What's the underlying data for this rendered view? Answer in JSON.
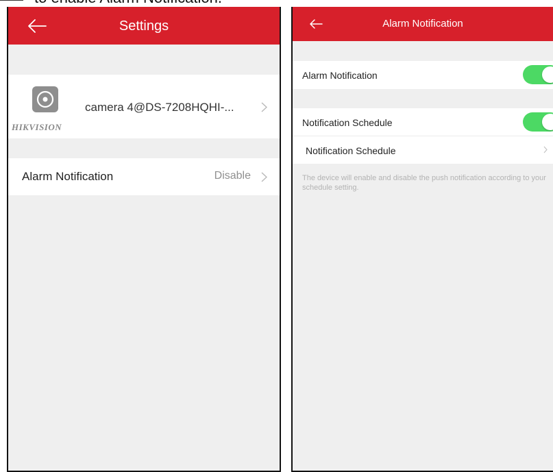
{
  "caption": {
    "text": "to enable Alarm Notification."
  },
  "left_screen": {
    "header": {
      "title": "Settings",
      "back_icon": "arrow-left-icon"
    },
    "device": {
      "name": "camera 4@DS-7208HQHI-...",
      "brand": "HIKVISION",
      "icon": "camera-lens-icon"
    },
    "alarm_row": {
      "label": "Alarm Notification",
      "value": "Disable"
    }
  },
  "right_screen": {
    "header": {
      "title": "Alarm Notification",
      "back_icon": "arrow-left-icon"
    },
    "alarm_notification": {
      "label": "Alarm Notification",
      "enabled": true
    },
    "schedule_toggle": {
      "label": "Notification Schedule",
      "enabled": true
    },
    "schedule_link": {
      "label": "Notification Schedule"
    },
    "note": "The device will enable and disable the push notification according to your schedule setting."
  },
  "colors": {
    "header_red": "#d7202b",
    "toggle_green": "#4cd964",
    "background": "#efefef"
  }
}
